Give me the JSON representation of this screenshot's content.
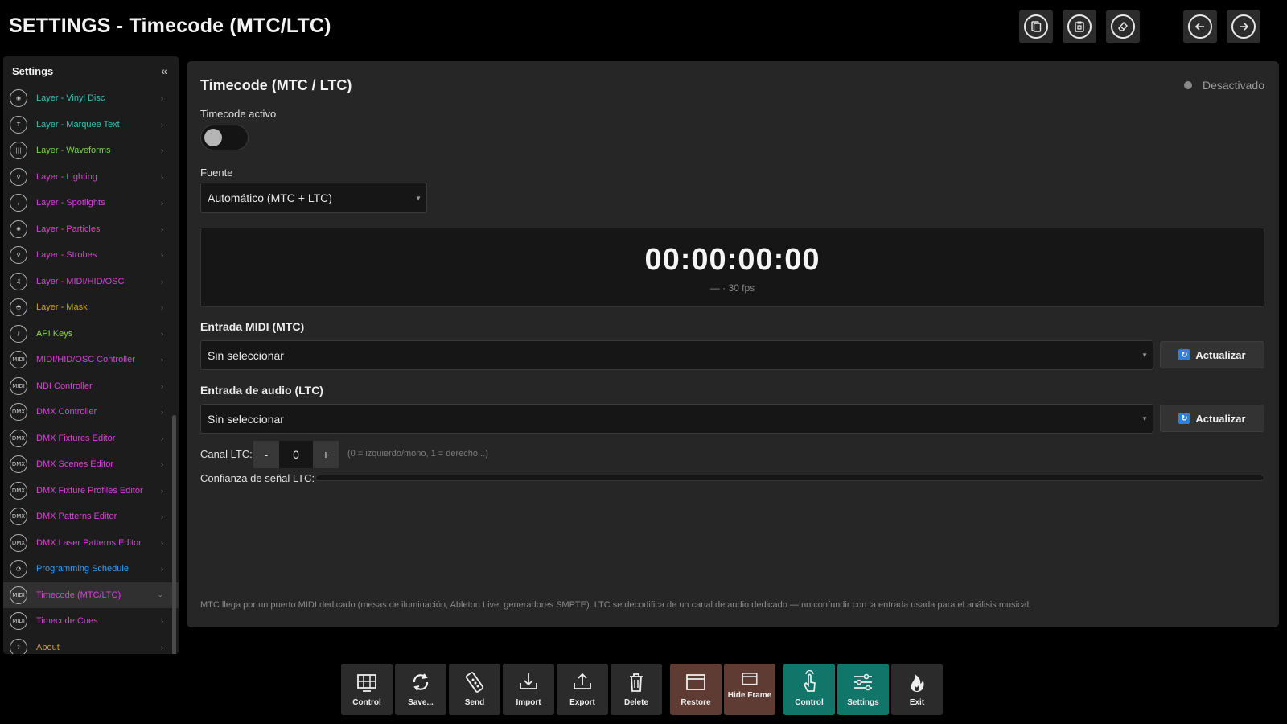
{
  "window": {
    "title": "SETTINGS - Timecode (MTC/LTC)"
  },
  "top_buttons": [
    {
      "name": "copy-button",
      "icon": "copy-icon"
    },
    {
      "name": "paste-button",
      "icon": "clipboard-icon"
    },
    {
      "name": "eraser-button",
      "icon": "eraser-icon"
    },
    {
      "name": "back-button",
      "icon": "arrow-left-icon"
    },
    {
      "name": "forward-button",
      "icon": "arrow-right-icon"
    }
  ],
  "sidebar": {
    "title": "Settings",
    "collapse_glyph": "«",
    "items": [
      {
        "label": "Layer - Vinyl Disc",
        "color": "#3fbfb5",
        "icon": "disc-icon",
        "glyph": "◉"
      },
      {
        "label": "Layer - Marquee Text",
        "color": "#3fbfb5",
        "icon": "text-icon",
        "glyph": "T"
      },
      {
        "label": "Layer - Waveforms",
        "color": "#7fcf4f",
        "icon": "waveform-icon",
        "glyph": "|||"
      },
      {
        "label": "Layer - Lighting",
        "color": "#d445d4",
        "icon": "bulb-icon",
        "glyph": "♀"
      },
      {
        "label": "Layer - Spotlights",
        "color": "#d445d4",
        "icon": "spotlight-icon",
        "glyph": "/"
      },
      {
        "label": "Layer - Particles",
        "color": "#d445d4",
        "icon": "particles-icon",
        "glyph": "✺"
      },
      {
        "label": "Layer - Strobes",
        "color": "#d445d4",
        "icon": "strobe-icon",
        "glyph": "♀"
      },
      {
        "label": "Layer - MIDI/HID/OSC",
        "color": "#d445d4",
        "icon": "midi-layer-icon",
        "glyph": "♫"
      },
      {
        "label": "Layer - Mask",
        "color": "#c8a020",
        "icon": "mask-icon",
        "glyph": "◓"
      },
      {
        "label": "API Keys",
        "color": "#8fd44a",
        "icon": "key-icon",
        "glyph": "⚷"
      },
      {
        "label": "MIDI/HID/OSC Controller",
        "color": "#d445d4",
        "icon": "midi-icon",
        "glyph": "MIDI"
      },
      {
        "label": "NDI Controller",
        "color": "#d445d4",
        "icon": "ndi-icon",
        "glyph": "MIDI"
      },
      {
        "label": "DMX Controller",
        "color": "#d445d4",
        "icon": "dmx-icon",
        "glyph": "DMX"
      },
      {
        "label": "DMX Fixtures Editor",
        "color": "#d445d4",
        "icon": "dmx-fixtures-icon",
        "glyph": "DMX"
      },
      {
        "label": "DMX Scenes Editor",
        "color": "#d445d4",
        "icon": "dmx-scenes-icon",
        "glyph": "DMX"
      },
      {
        "label": "DMX Fixture Profiles Editor",
        "color": "#d445d4",
        "icon": "dmx-profiles-icon",
        "glyph": "DMX"
      },
      {
        "label": "DMX Patterns Editor",
        "color": "#d445d4",
        "icon": "dmx-patterns-icon",
        "glyph": "DMX"
      },
      {
        "label": "DMX Laser Patterns Editor",
        "color": "#d445d4",
        "icon": "dmx-laser-icon",
        "glyph": "DMX"
      },
      {
        "label": "Programming Schedule",
        "color": "#3a9cf0",
        "icon": "schedule-icon",
        "glyph": "◔"
      },
      {
        "label": "Timecode (MTC/LTC)",
        "color": "#d445d4",
        "icon": "timecode-icon",
        "glyph": "MIDI",
        "active": true
      },
      {
        "label": "Timecode Cues",
        "color": "#d445d4",
        "icon": "timecode-cues-icon",
        "glyph": "MIDI"
      },
      {
        "label": "About",
        "color": "#d4a020",
        "icon": "info-icon",
        "glyph": "?"
      }
    ]
  },
  "panel": {
    "title": "Timecode (MTC / LTC)",
    "status": "Desactivado",
    "toggle_label": "Timecode activo",
    "toggle_on": false,
    "source_label": "Fuente",
    "source_value": "Automático (MTC + LTC)",
    "timecode": "00:00:00:00",
    "timecode_sub": "— · 30 fps",
    "midi_section": "Entrada MIDI (MTC)",
    "midi_value": "Sin seleccionar",
    "audio_section": "Entrada de audio (LTC)",
    "audio_value": "Sin seleccionar",
    "refresh_label": "Actualizar",
    "channel_label": "Canal LTC:",
    "channel_minus": "-",
    "channel_value": "0",
    "channel_plus": "+",
    "channel_hint": "(0 = izquierdo/mono, 1 = derecho...)",
    "confidence_label": "Confianza de señal LTC:",
    "confidence_value": 0,
    "footnote": "MTC llega por un puerto MIDI dedicado (mesas de iluminación, Ableton Live, generadores SMPTE). LTC se decodifica de un canal de audio dedicado — no confundir con la entrada usada para el análisis musical."
  },
  "toolbar": {
    "control": "Control",
    "save": "Save...",
    "send": "Send",
    "import": "Import",
    "export": "Export",
    "delete": "Delete",
    "restore": "Restore",
    "hide_frame": "Hide Frame",
    "control2": "Control",
    "settings": "Settings",
    "exit": "Exit"
  }
}
